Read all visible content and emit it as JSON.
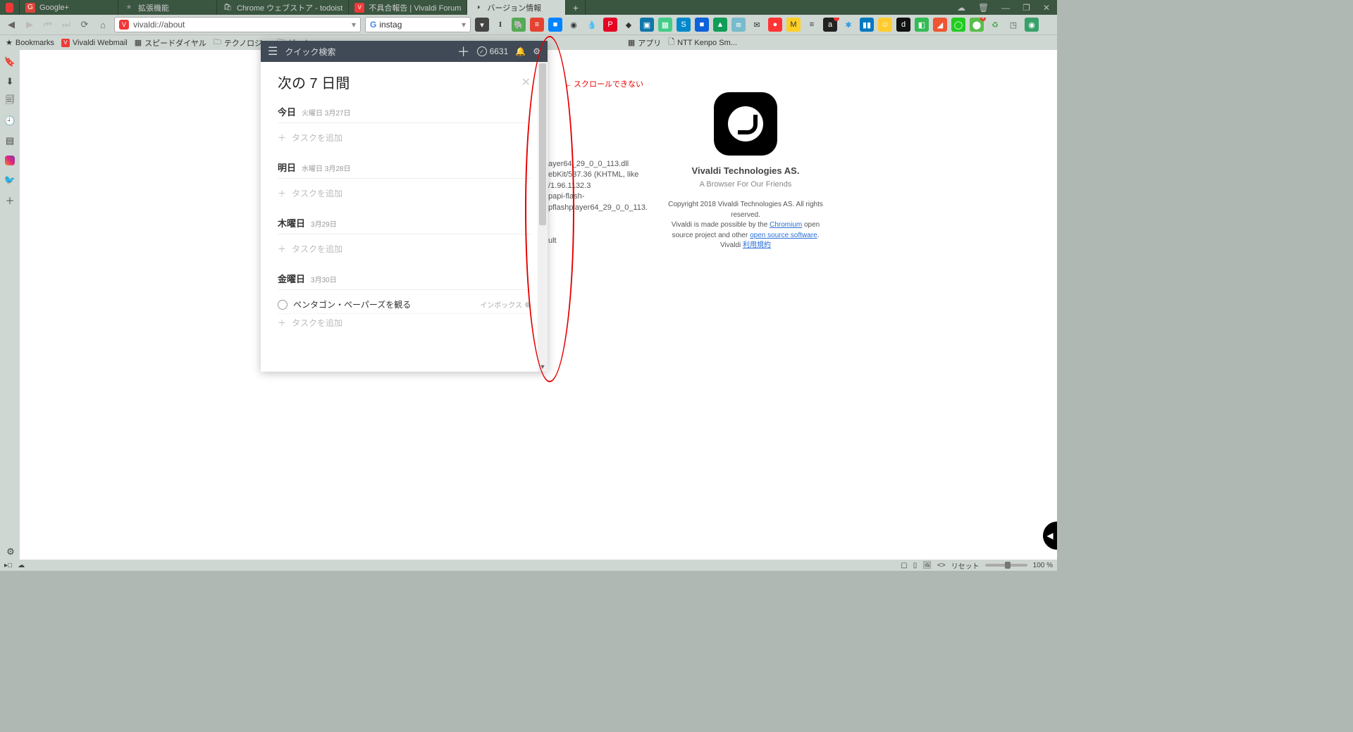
{
  "tabs": [
    {
      "title": "Google+",
      "icon": "G+",
      "bg": "#db4437"
    },
    {
      "title": "拡張機能",
      "icon": "★",
      "bg": "#888"
    },
    {
      "title": "Chrome ウェブストア - todoist",
      "icon": "◐",
      "bg": "#fff"
    },
    {
      "title": "不具合報告 | Vivaldi Forum",
      "icon": "V",
      "bg": "#ef3939"
    },
    {
      "title": "バージョン情報",
      "icon": "◑",
      "bg": "#fff",
      "active": true
    }
  ],
  "address": {
    "url": "vivaldi://about"
  },
  "search": {
    "query": "instag",
    "engine": "G"
  },
  "bookmarks": [
    {
      "label": "Bookmarks",
      "icon": "★"
    },
    {
      "label": "Vivaldi Webmail",
      "icon": "V",
      "bg": "#ef3939"
    },
    {
      "label": "スピードダイヤル",
      "icon": "▦"
    },
    {
      "label": "テクノロジー",
      "icon": "🗀"
    },
    {
      "label": "ゲーム",
      "icon": "🗀"
    },
    {
      "label": "アプリ",
      "icon": "▦"
    },
    {
      "label": "NTT Kenpo Sm...",
      "icon": "🗋"
    }
  ],
  "annotation": "スクロールできない",
  "todoist": {
    "header": {
      "search": "クイック検索",
      "count": "6631"
    },
    "title": "次の 7 日間",
    "addTask": "タスクを追加",
    "days": [
      {
        "name": "今日",
        "date": "火曜日 3月27日",
        "tasks": []
      },
      {
        "name": "明日",
        "date": "水曜日 3月28日",
        "tasks": []
      },
      {
        "name": "木曜日",
        "date": "3月29日",
        "tasks": []
      },
      {
        "name": "金曜日",
        "date": "3月30日",
        "tasks": [
          {
            "title": "ペンタゴン・ペーパーズを観る",
            "inbox": "インボックス"
          }
        ]
      }
    ]
  },
  "about": {
    "company": "Vivaldi Technologies AS.",
    "tagline": "A Browser For Our Friends",
    "copyright": "Copyright 2018 Vivaldi Technologies AS. All rights reserved.",
    "line2_a": "Vivaldi is made possible by the ",
    "chromium": "Chromium",
    "line2_b": " open source project and other ",
    "oss": "open source software",
    "line3_a": "Vivaldi ",
    "terms": "利用規約",
    "frag1": "ayer64_29_0_0_113.dll",
    "frag2": "ebKit/537.36 (KHTML, like",
    "frag3": "/1.96.1132.3",
    "frag4": "papi-flash-",
    "frag5": "pflashplayer64_29_0_0_113.",
    "frag6": "ult"
  },
  "status": {
    "reset": "リセット",
    "zoom": "100 %"
  }
}
